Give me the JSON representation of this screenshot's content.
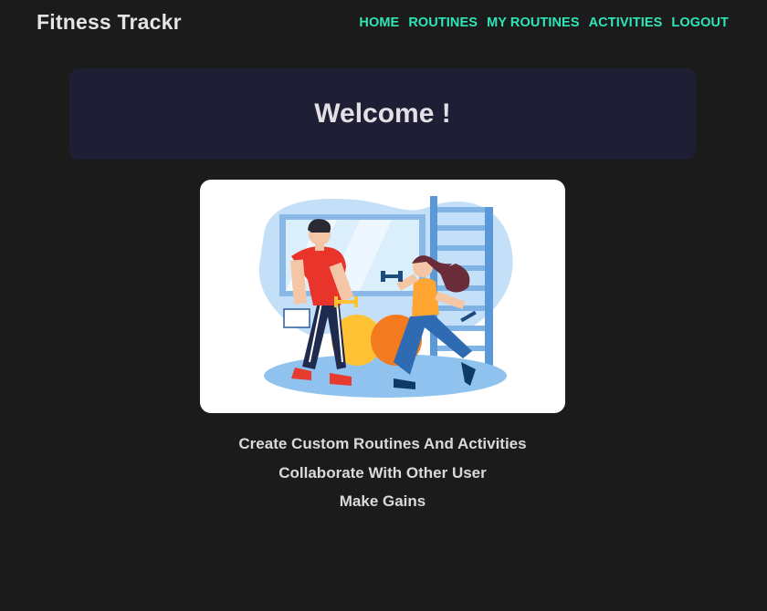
{
  "brand": {
    "title": "Fitness Trackr"
  },
  "nav": {
    "items": [
      {
        "label": "HOME"
      },
      {
        "label": "ROUTINES"
      },
      {
        "label": "MY ROUTINES"
      },
      {
        "label": "ACTIVITIES"
      },
      {
        "label": "LOGOUT"
      }
    ]
  },
  "welcome": {
    "title": "Welcome !"
  },
  "hero": {
    "illustration": "gym-couple-workout-illustration"
  },
  "taglines": [
    "Create Custom Routines And Activities",
    "Collaborate With Other User",
    "Make Gains"
  ],
  "colors": {
    "background": "#1b1b1b",
    "nav_link": "#2ee6b8",
    "panel": "#1e1f35",
    "text": "#e3dfe4"
  }
}
